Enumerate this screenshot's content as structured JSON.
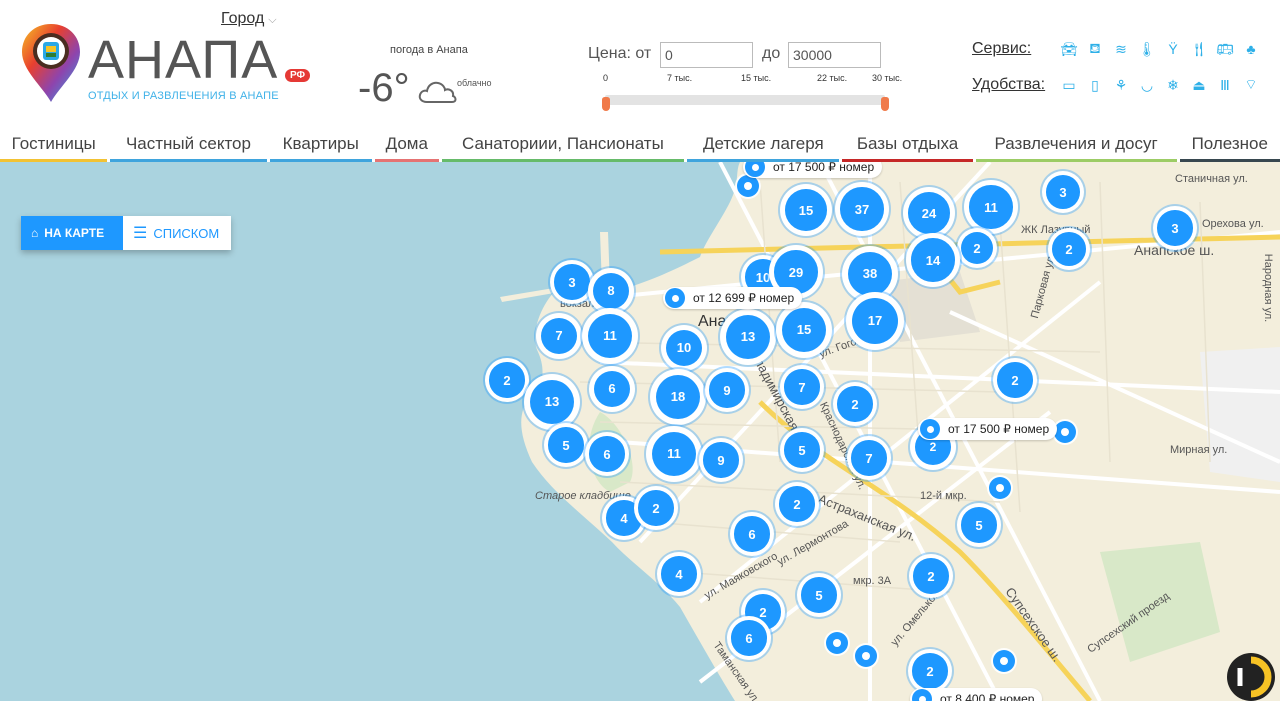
{
  "header": {
    "city_label": "Город",
    "logo": {
      "wordmark": "АНАПА",
      "rf": "РФ",
      "tagline": "ОТДЫХ И РАЗВЛЕЧЕНИЯ В АНАПЕ"
    },
    "weather": {
      "label": "погода в Анапа",
      "temperature": "-6°",
      "description": "облачно"
    },
    "price": {
      "from_label": "Цена: от",
      "to_label": "до",
      "from_value": "0",
      "to_value": "30000",
      "ticks": [
        "0",
        "7 тыс.",
        "15 тыс.",
        "22 тыс.",
        "30 тыс."
      ]
    },
    "service": {
      "label": "Сервис:",
      "icons": [
        "car-icon",
        "bed-icon",
        "swimmer-icon",
        "thermometer-icon",
        "glass-icon",
        "restaurant-icon",
        "bus-icon",
        "tree-icon"
      ]
    },
    "amenities": {
      "label": "Удобства:",
      "icons": [
        "tv-icon",
        "fridge-icon",
        "shower-icon",
        "bath-icon",
        "snowflake-icon",
        "kettle-icon",
        "radiator-icon",
        "wifi-icon"
      ]
    }
  },
  "nav": {
    "items": [
      {
        "label": "Гостиницы",
        "color": "#f2c233"
      },
      {
        "label": "Частный сектор",
        "color": "#3fa4dd"
      },
      {
        "label": "Квартиры",
        "color": "#3fa4dd"
      },
      {
        "label": "Дома",
        "color": "#e57373"
      },
      {
        "label": "Санаториии, Пансионаты",
        "color": "#66bb6a"
      },
      {
        "label": "Детские лагеря",
        "color": "#3fa4dd"
      },
      {
        "label": "Базы отдыха",
        "color": "#c62828"
      },
      {
        "label": "Развлечения и досуг",
        "color": "#9ccc65"
      },
      {
        "label": "Полезное",
        "color": "#37474f"
      }
    ]
  },
  "map": {
    "view_toggle": {
      "map_label": "НА КАРТЕ",
      "list_label": "СПИСКОМ"
    },
    "place_name": "Анапа",
    "clusters": [
      "15",
      "37",
      "24",
      "11",
      "3",
      "2",
      "2",
      "3",
      "10",
      "29",
      "38",
      "14",
      "3",
      "8",
      "17",
      "7",
      "11",
      "13",
      "15",
      "10",
      "2",
      "13",
      "6",
      "18",
      "9",
      "7",
      "2",
      "5",
      "6",
      "11",
      "9",
      "5",
      "7",
      "2",
      "4",
      "2",
      "2",
      "6",
      "5",
      "4",
      "2",
      "5",
      "2",
      "6",
      "2"
    ],
    "price_labels": [
      "от 17 500 ₽ номер",
      "от 12 699 ₽ номер",
      "от 17 500 ₽ номер",
      "от 8 400 ₽ номер"
    ],
    "streets": [
      "Станичная ул.",
      "Орехова ул.",
      "Анапское ш.",
      "ЖК Лазурный",
      "Парковая ул.",
      "Народная ул.",
      "Мирная ул.",
      "ул. Гоголя",
      "Астраханская ул.",
      "12-й мкр.",
      "Супсехское ш.",
      "Супсехский проезд",
      "мкр. 3А",
      "ул. Лермонтова",
      "ул. Маяковского",
      "Старое кладбище",
      "ул. Омелькова",
      "Таманская ул.",
      "Владимирская ул.",
      "вокзал",
      "Краснодарская ул."
    ]
  }
}
